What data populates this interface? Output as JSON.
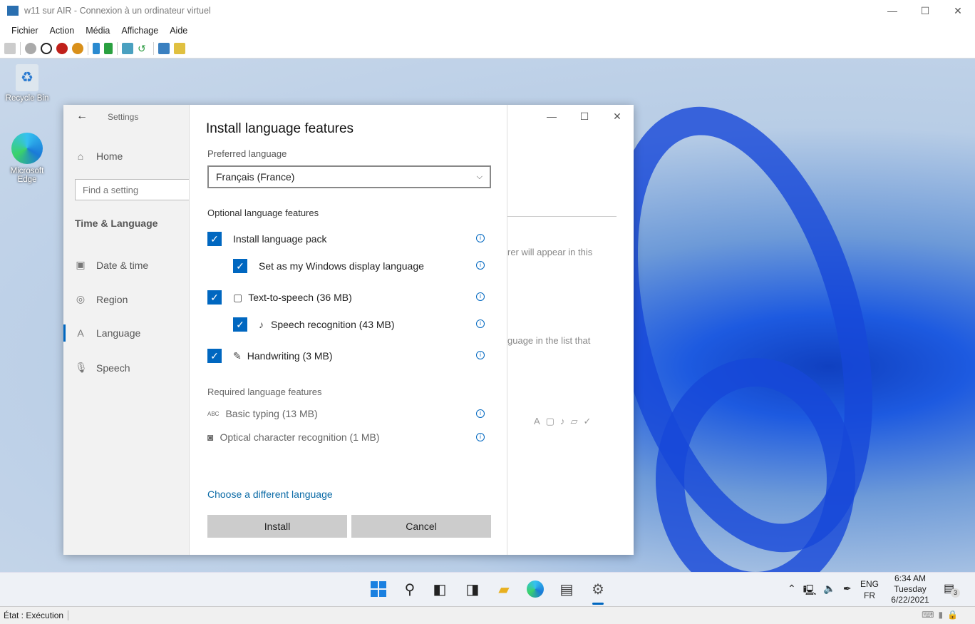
{
  "window": {
    "title": "w11 sur AIR - Connexion à un ordinateur virtuel"
  },
  "menu": [
    "Fichier",
    "Action",
    "Média",
    "Affichage",
    "Aide"
  ],
  "desktop": {
    "icons": [
      "Recycle Bin",
      "Microsoft Edge"
    ]
  },
  "settings": {
    "title": "Settings",
    "home": "Home",
    "search_placeholder": "Find a setting",
    "section": "Time & Language",
    "nav": [
      "Date & time",
      "Region",
      "Language",
      "Speech"
    ],
    "background_text": [
      "rer will appear in this",
      "guage in the list that"
    ]
  },
  "dialog": {
    "title": "Install language features",
    "preferred_label": "Preferred language",
    "preferred_value": "Français (France)",
    "optional_label": "Optional language features",
    "optional": [
      {
        "label": "Install language pack",
        "checked": true
      },
      {
        "label": "Set as my Windows display language",
        "checked": true
      },
      {
        "label": "Text-to-speech (36 MB)",
        "checked": true
      },
      {
        "label": "Speech recognition (43 MB)",
        "checked": true
      },
      {
        "label": "Handwriting (3 MB)",
        "checked": true
      }
    ],
    "required_label": "Required language features",
    "required": [
      "Basic typing (13 MB)",
      "Optical character recognition (1 MB)"
    ],
    "link": "Choose a different language",
    "install": "Install",
    "cancel": "Cancel"
  },
  "tray": {
    "lang1": "ENG",
    "lang2": "FR",
    "time": "6:34 AM",
    "day": "Tuesday",
    "date": "6/22/2021",
    "notifications": "3"
  },
  "status": "État : Exécution"
}
